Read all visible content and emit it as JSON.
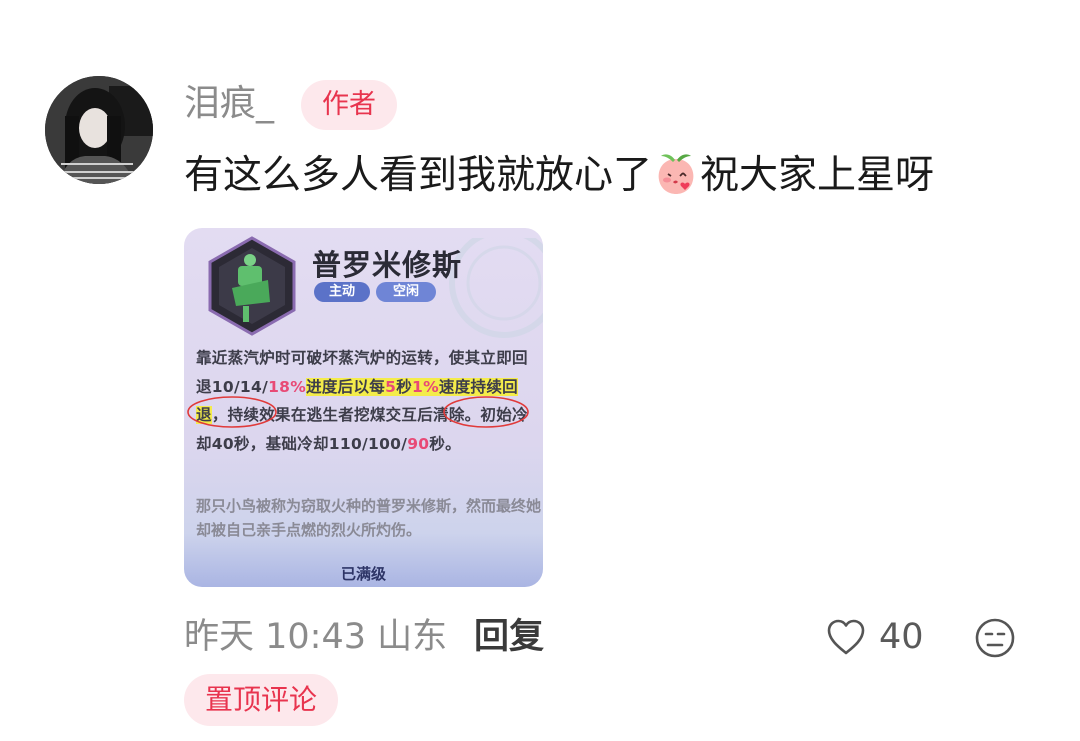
{
  "comment": {
    "username": "泪痕_",
    "author_badge": "作者",
    "text_before_emoji": "有这么多人看到我就放心了",
    "emoji": "peach-blowing-kiss-emoji",
    "text_after_emoji": "祝大家上星呀",
    "timestamp": "昨天 10:43",
    "location": "山东",
    "reply_label": "回复",
    "like_count": "40",
    "pinned_label": "置顶评论"
  },
  "attachment": {
    "title": "普罗米修斯",
    "tags": [
      "主动",
      "空闲"
    ],
    "desc": {
      "p1": "靠近蒸汽炉时可破坏蒸汽炉的运转，使其立即回退10/14/",
      "p2": "18%",
      "p3": "进度后以每",
      "p4": "5",
      "p5": "秒",
      "p6": "1%",
      "p7": "速度持续回退",
      "p8": "，持续效果在逃生者挖煤交互后清除。初始冷却40秒，基础冷却110/100/",
      "p9": "90",
      "p10": "秒。"
    },
    "lore": "那只小鸟被称为窃取火种的普罗米修斯，然而最终她却被自己亲手点燃的烈火所灼伤。",
    "footer": "已满级"
  },
  "colors": {
    "accent": "#e8344e",
    "badge_bg": "#fde8ec",
    "meta_gray": "#8b8b8b"
  }
}
